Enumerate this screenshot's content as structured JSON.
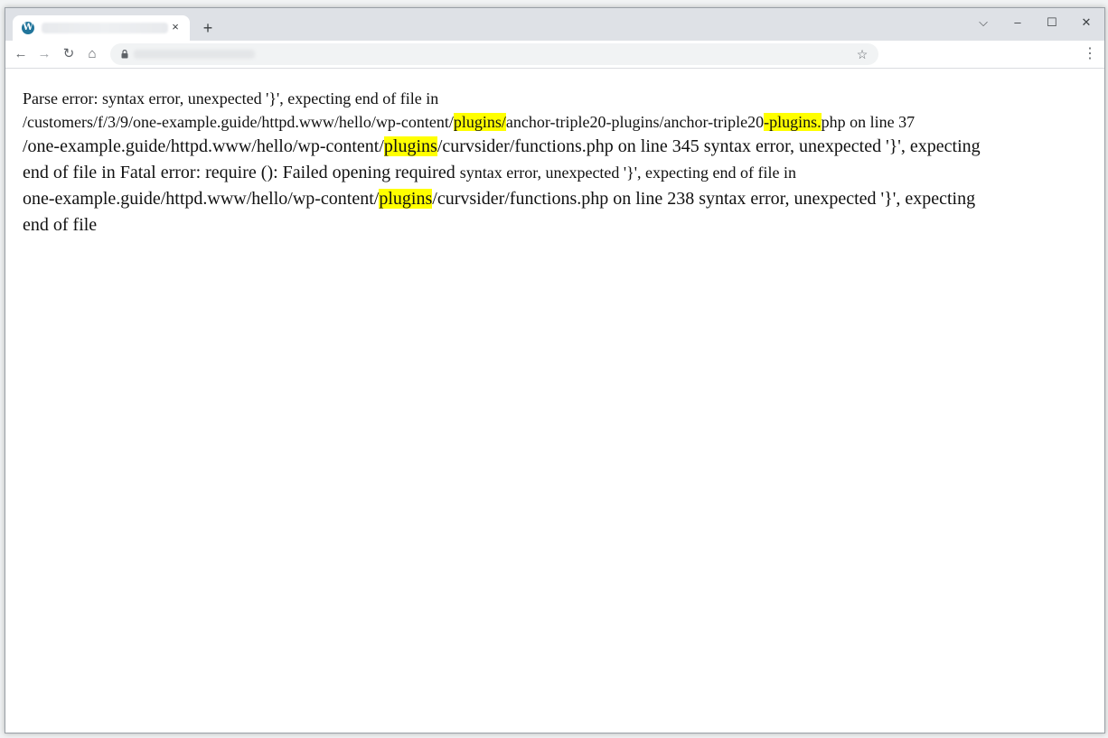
{
  "browser": {
    "tab": {
      "favicon": "W",
      "close": "×"
    },
    "new_tab": "+",
    "window_controls": {
      "search_tabs": "⌵",
      "minimize": "–",
      "maximize": "☐",
      "close": "✕"
    },
    "nav": {
      "back": "←",
      "forward": "→",
      "reload": "↻",
      "home": "⌂"
    },
    "bookmark": "☆",
    "menu": "⋮"
  },
  "page": {
    "line1": {
      "a": "Parse error: syntax error, unexpected '}', expecting end of file in"
    },
    "line2": {
      "a": "/customers/f/3/9/one-example.guide/httpd.www/hello/wp-content/",
      "hl1": "plugins/",
      "b": "anchor-triple20-plugins/anchor-triple20",
      "hl2": "-plugins.",
      "c": "php on line 37"
    },
    "line3": {
      "a": "/one-example.guide/httpd.www/hello/wp-content/",
      "hl": "plugins",
      "b": "/curvsider/functions.php on line 345 syntax error, unexpected '}', expecting"
    },
    "line4": {
      "a": "end of file in Fatal error: require (): Failed opening required ",
      "b": "syntax error, unexpected '}', expecting end of file in"
    },
    "line5": {
      "a": "one-example.guide/httpd.www/hello/wp-content/",
      "hl": "plugins",
      "b": "/curvsider/functions.php on line 238 syntax error, unexpected '}', expecting"
    },
    "line6": {
      "a": "end of file"
    },
    "highlight_color": "#ffff00"
  }
}
